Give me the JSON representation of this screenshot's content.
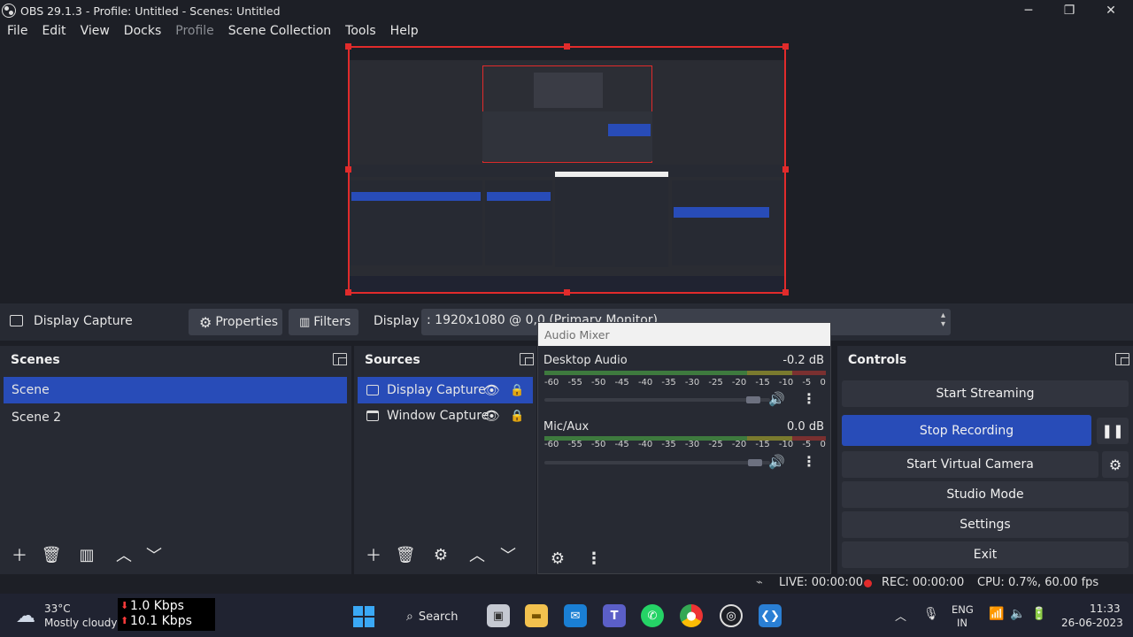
{
  "window": {
    "title": "OBS 29.1.3 - Profile: Untitled - Scenes: Untitled",
    "minimize": "─",
    "restore": "❐",
    "close": "✕"
  },
  "menu": [
    "File",
    "Edit",
    "View",
    "Docks",
    "Profile",
    "Scene Collection",
    "Tools",
    "Help"
  ],
  "source_toolbar": {
    "source_name": "Display Capture",
    "properties_label": "Properties",
    "filters_label": "Filters",
    "display_label": "Display",
    "display_value": ": 1920x1080 @ 0,0 (Primary Monitor)"
  },
  "scenes": {
    "title": "Scenes",
    "items": [
      "Scene",
      "Scene 2"
    ]
  },
  "sources": {
    "title": "Sources",
    "items": [
      "Display Capture",
      "Window Capture"
    ]
  },
  "mixer": {
    "title": "Audio Mixer",
    "channels": [
      {
        "name": "Desktop Audio",
        "level": "-0.2 dB"
      },
      {
        "name": "Mic/Aux",
        "level": "0.0 dB"
      }
    ],
    "scale": [
      "-60",
      "-55",
      "-50",
      "-45",
      "-40",
      "-35",
      "-30",
      "-25",
      "-20",
      "-15",
      "-10",
      "-5",
      "0"
    ]
  },
  "controls": {
    "title": "Controls",
    "start_streaming": "Start Streaming",
    "stop_recording": "Stop Recording",
    "start_virtual_camera": "Start Virtual Camera",
    "studio_mode": "Studio Mode",
    "settings": "Settings",
    "exit": "Exit"
  },
  "status": {
    "live": "LIVE: 00:00:00",
    "rec": "REC: 00:00:00",
    "cpu": "CPU: 0.7%, 60.00 fps"
  },
  "taskbar": {
    "weather_temp": "33°C",
    "weather_desc": "Mostly cloudy",
    "net_down": "1.0 Kbps",
    "net_up": "10.1 Kbps",
    "search": "Search",
    "lang_top": "ENG",
    "lang_bottom": "IN",
    "time": "11:33",
    "date": "26-06-2023"
  },
  "colors": {
    "accent": "#284cb8",
    "preview_border": "#e12b2b",
    "rec_dot": "#e12b2b"
  }
}
